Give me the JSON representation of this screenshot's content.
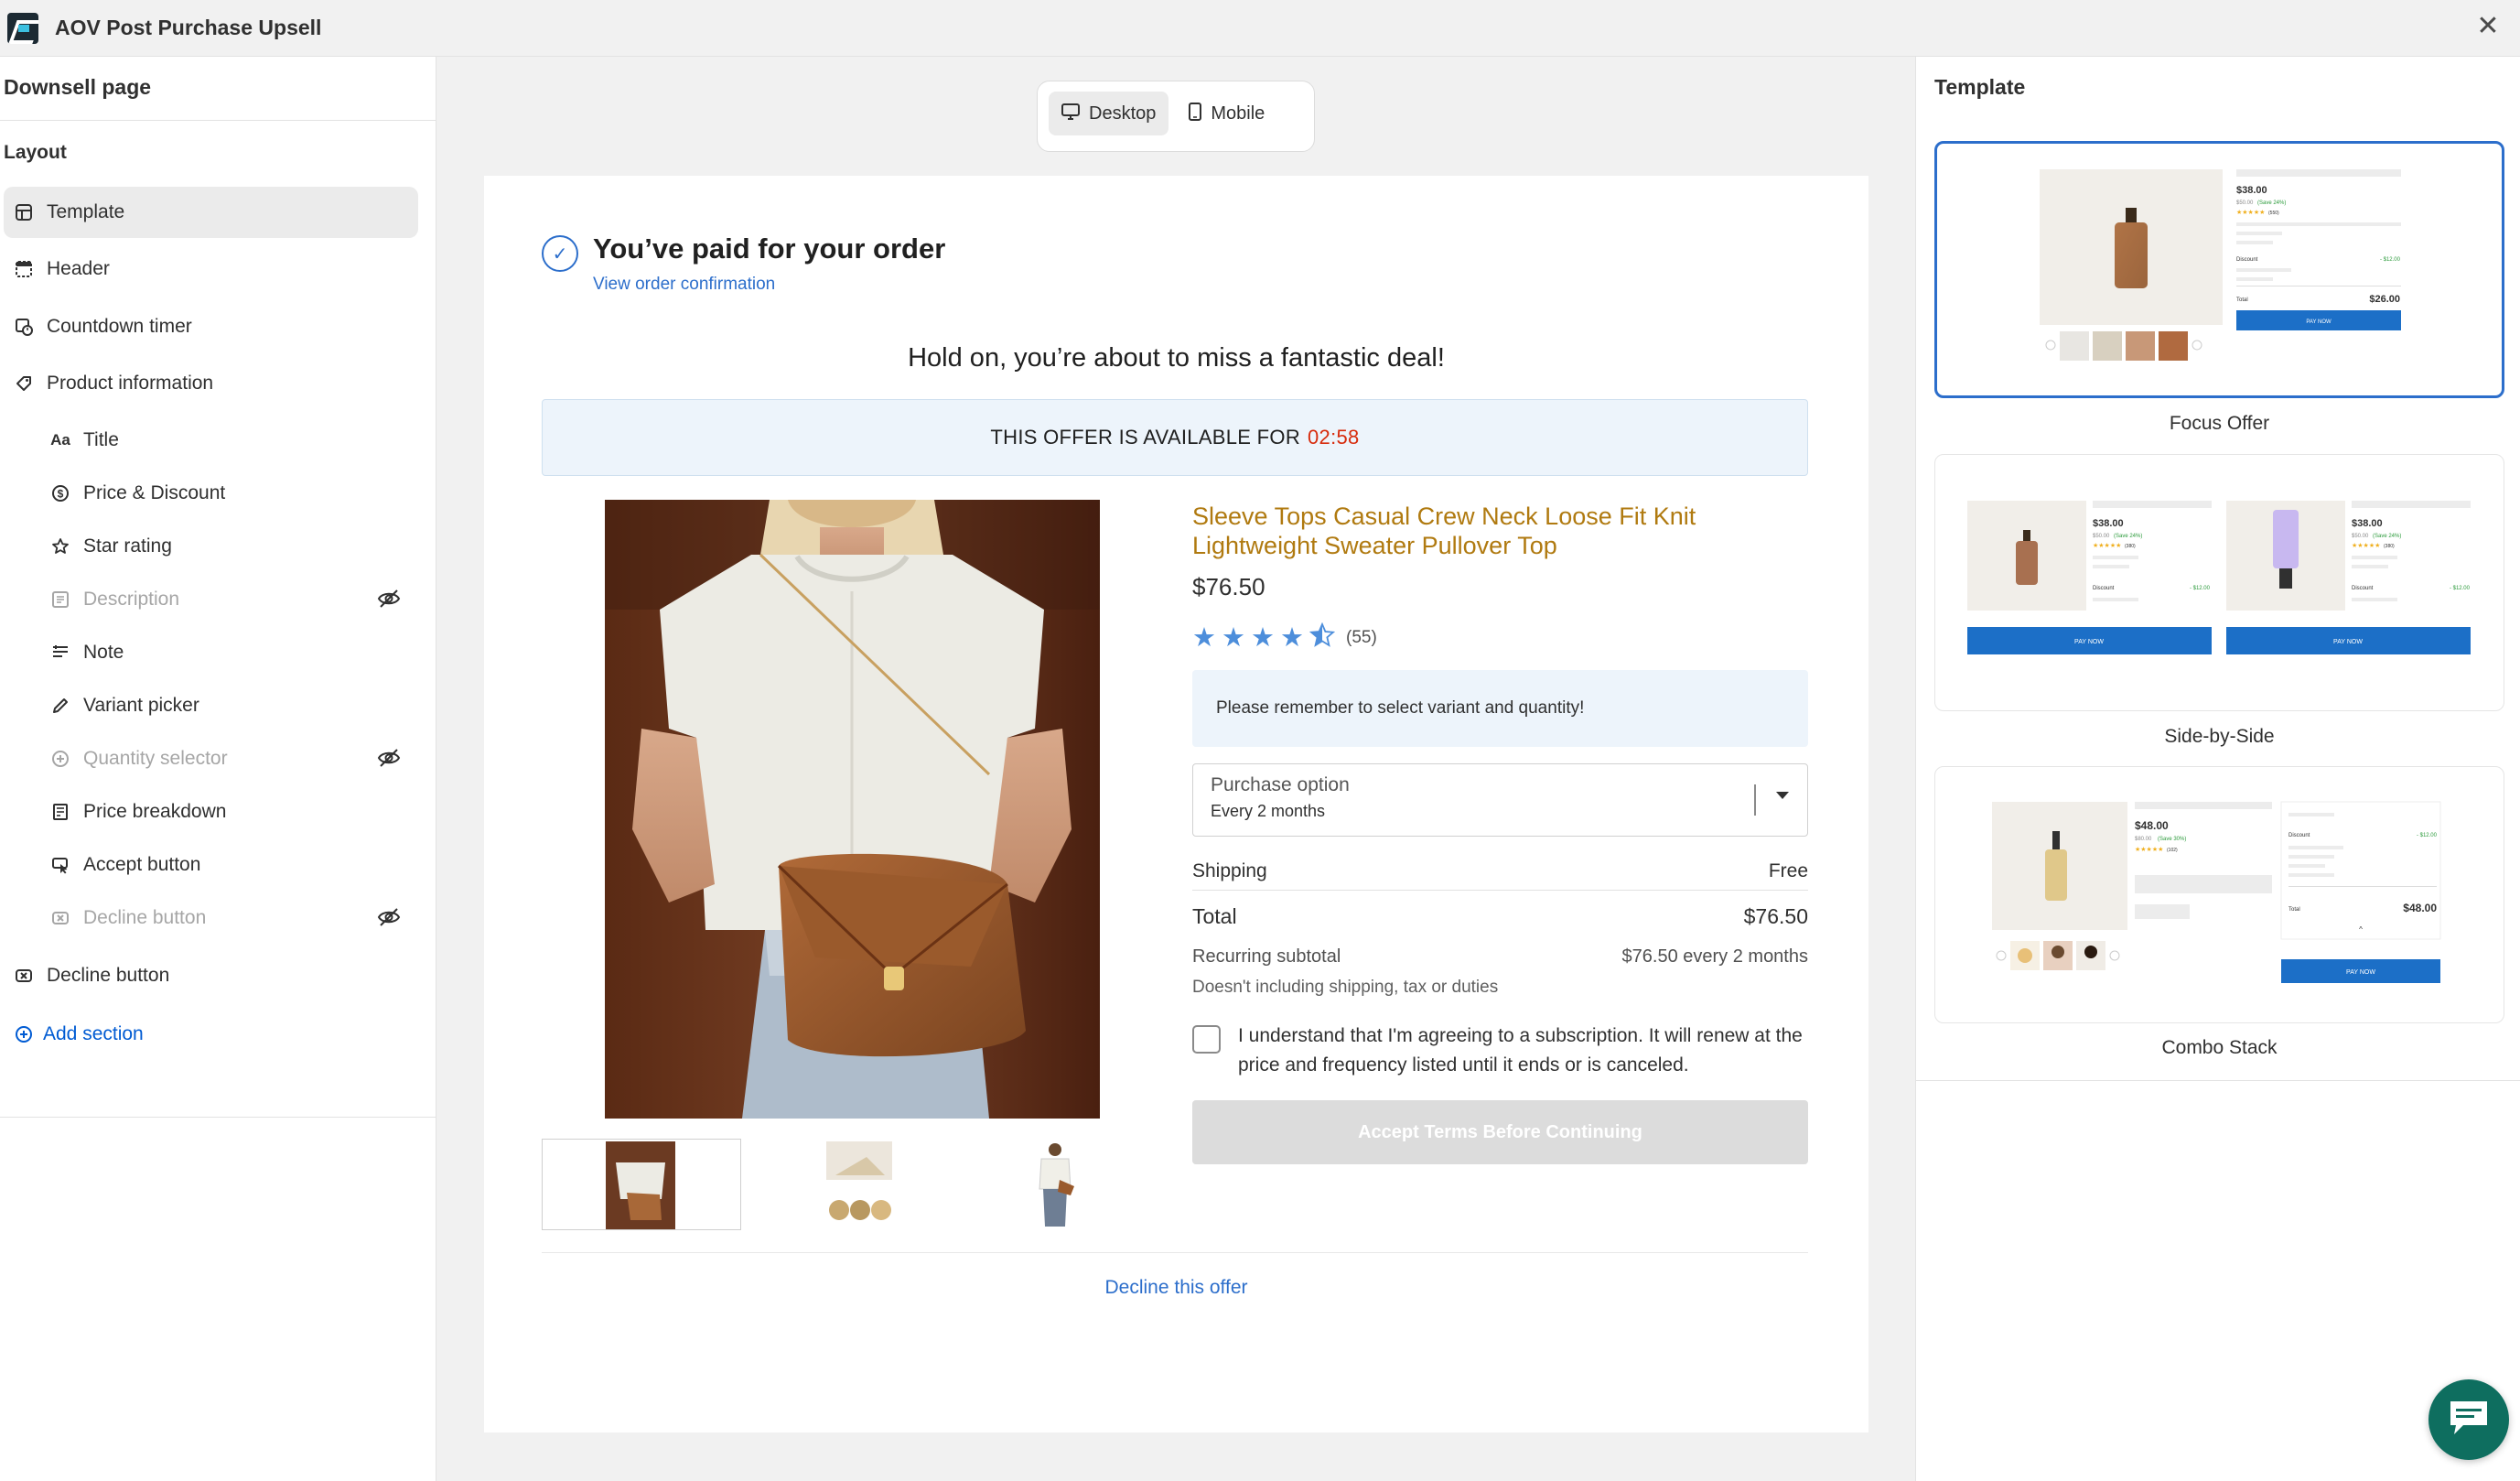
{
  "app": {
    "title": "AOV Post Purchase Upsell"
  },
  "sidebar": {
    "heading": "Downsell page",
    "layout_label": "Layout",
    "template_item": "Template",
    "sections": [
      {
        "label": "Header"
      },
      {
        "label": "Countdown timer"
      },
      {
        "label": "Product information"
      }
    ],
    "product_blocks": [
      {
        "label": "Title",
        "hidden": false
      },
      {
        "label": "Price & Discount",
        "hidden": false
      },
      {
        "label": "Star rating",
        "hidden": false
      },
      {
        "label": "Description",
        "hidden": true
      },
      {
        "label": "Note",
        "hidden": false
      },
      {
        "label": "Variant picker",
        "hidden": false
      },
      {
        "label": "Quantity selector",
        "hidden": true
      },
      {
        "label": "Price breakdown",
        "hidden": false
      },
      {
        "label": "Accept button",
        "hidden": false
      },
      {
        "label": "Decline button",
        "hidden": true
      }
    ],
    "decline_section": "Decline button",
    "add_section": "Add section"
  },
  "view_toggle": {
    "desktop": "Desktop",
    "mobile": "Mobile",
    "active": "Desktop"
  },
  "preview": {
    "paid_title": "You’ve paid for your order",
    "view_confirmation": "View order confirmation",
    "deal_heading": "Hold on, you’re about to miss a fantastic deal!",
    "offer_banner": "THIS OFFER IS AVAILABLE FOR",
    "offer_timer": "02:58",
    "product_title": "Sleeve Tops Casual Crew Neck Loose Fit Knit Lightweight Sweater Pullover Top",
    "price": "$76.50",
    "rating": 4.5,
    "review_count": "(55)",
    "note": "Please remember to select variant and quantity!",
    "purchase_option_label": "Purchase option",
    "purchase_option_value": "Every 2 months",
    "shipping_label": "Shipping",
    "shipping_value": "Free",
    "total_label": "Total",
    "total_value": "$76.50",
    "recurring_label": "Recurring subtotal",
    "recurring_value": "$76.50 every 2 months",
    "excludes_note": "Doesn't including shipping, tax or duties",
    "agreement": "I understand that I'm agreeing to a subscription. It will renew at the price and frequency listed until it ends or is canceled.",
    "accept_button": "Accept Terms Before Continuing",
    "decline_link": "Decline this offer",
    "title_color": "#b07a10",
    "link_color": "#2c6ecb",
    "timer_color": "#d72c0d"
  },
  "templates": {
    "heading": "Template",
    "items": [
      {
        "name": "Focus Offer",
        "selected": true,
        "price": "$38.00",
        "strike": "$50.00",
        "save": "(Save 24%)",
        "reviews": "(550)",
        "discount_label": "Discount",
        "discount": "- $12.00",
        "total_label": "Total",
        "total": "$26.00",
        "button": "PAY NOW"
      },
      {
        "name": "Side-by-Side",
        "selected": false,
        "price": "$38.00",
        "strike": "$50.00",
        "save": "(Save 24%)",
        "reviews": "(380)",
        "discount_label": "Discount",
        "discount": "- $12.00",
        "button": "PAY NOW"
      },
      {
        "name": "Combo Stack",
        "selected": false,
        "price": "$48.00",
        "strike": "$80.00",
        "save": "(Save 30%)",
        "reviews": "(102)",
        "discount_label": "Discount",
        "discount": "- $12.00",
        "total_label": "Total",
        "total": "$48.00",
        "button": "PAY NOW"
      }
    ]
  }
}
